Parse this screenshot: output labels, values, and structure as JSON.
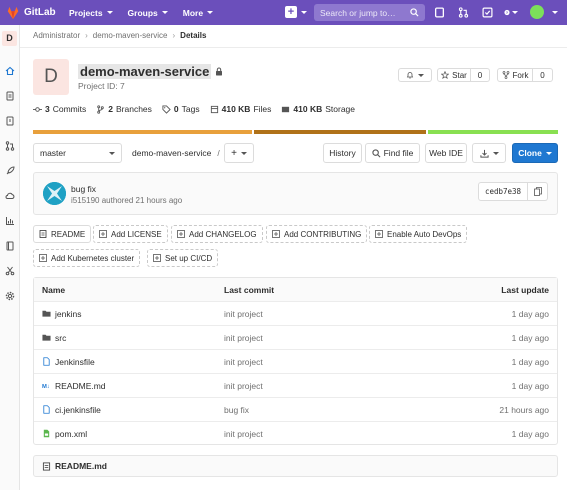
{
  "topbar": {
    "brand": "GitLab",
    "nav": [
      "Projects",
      "Groups",
      "More"
    ],
    "search_placeholder": "Search or jump to…"
  },
  "sidebar": {
    "project_letter": "D"
  },
  "breadcrumb": [
    "Administrator",
    "demo-maven-service",
    "Details"
  ],
  "project": {
    "letter": "D",
    "name": "demo-maven-service",
    "id_label": "Project ID: 7",
    "star_label": "Star",
    "star_count": "0",
    "fork_label": "Fork",
    "fork_count": "0"
  },
  "stats": [
    {
      "value": "3",
      "label": "Commits",
      "icon": "commit-icon"
    },
    {
      "value": "2",
      "label": "Branches",
      "icon": "branch-icon"
    },
    {
      "value": "0",
      "label": "Tags",
      "icon": "tag-icon"
    },
    {
      "value": "410 KB",
      "label": "Files",
      "icon": "file-icon"
    },
    {
      "value": "410 KB",
      "label": "Storage",
      "icon": "storage-icon"
    }
  ],
  "languages": [
    {
      "fraction": 0.42,
      "color": "#e8a03c"
    },
    {
      "fraction": 0.33,
      "color": "#b07219"
    },
    {
      "fraction": 0.25,
      "color": "#89e051"
    }
  ],
  "toolbar": {
    "branch": "master",
    "path": "demo-maven-service",
    "path_sep": "/",
    "plus": "+",
    "history": "History",
    "find_file": "Find file",
    "web_ide": "Web IDE",
    "clone": "Clone"
  },
  "commit": {
    "message": "bug fix",
    "meta": "i515190 authored 21 hours ago",
    "sha": "cedb7e38"
  },
  "actions": [
    "README",
    "Add LICENSE",
    "Add CHANGELOG",
    "Add CONTRIBUTING",
    "Enable Auto DevOps",
    "Add Kubernetes cluster",
    "Set up CI/CD"
  ],
  "table": {
    "headers": [
      "Name",
      "Last commit",
      "Last update"
    ],
    "rows": [
      {
        "name": "jenkins",
        "commit": "init project",
        "update": "1 day ago",
        "icon": "folder-icon"
      },
      {
        "name": "src",
        "commit": "init project",
        "update": "1 day ago",
        "icon": "folder-icon"
      },
      {
        "name": "Jenkinsfile",
        "commit": "init project",
        "update": "1 day ago",
        "icon": "file-icon"
      },
      {
        "name": "README.md",
        "commit": "init project",
        "update": "1 day ago",
        "icon": "markdown-icon"
      },
      {
        "name": "ci.jenkinsfile",
        "commit": "bug fix",
        "update": "21 hours ago",
        "icon": "file-icon"
      },
      {
        "name": "pom.xml",
        "commit": "init project",
        "update": "1 day ago",
        "icon": "xml-file-icon"
      }
    ]
  },
  "readme_title": "README.md",
  "colors": {
    "topbar": "#6b4fbb",
    "clone": "#1f78d1"
  }
}
